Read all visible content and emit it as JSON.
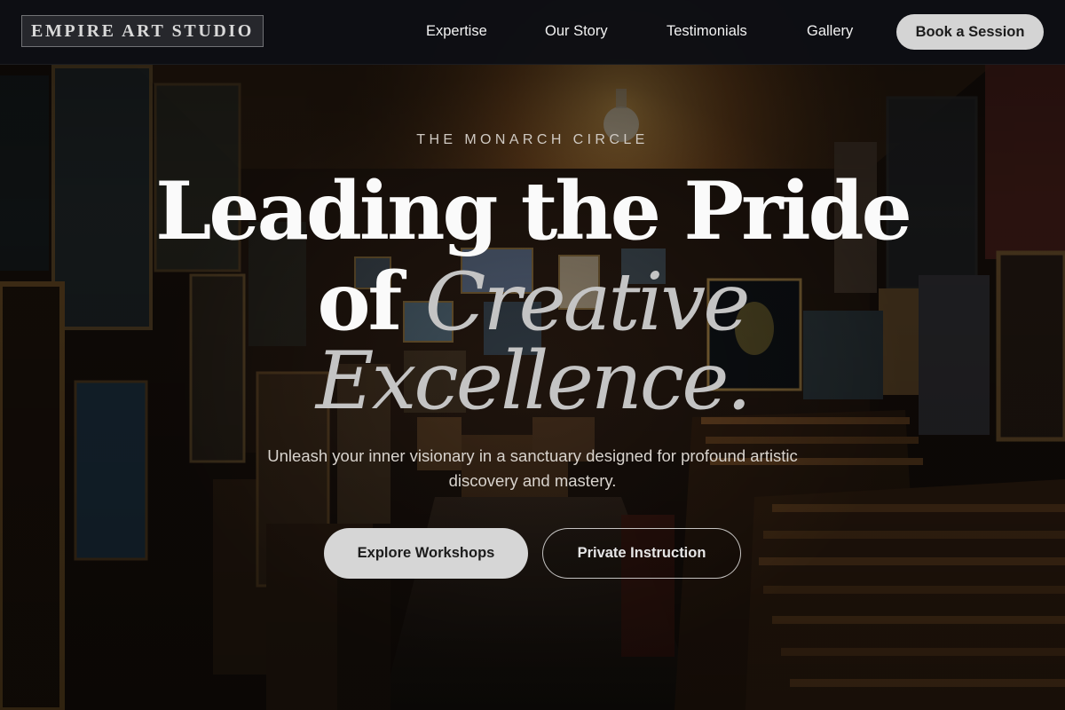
{
  "brand": {
    "logo_text": "EMPIRE ART STUDIO"
  },
  "nav": {
    "links": [
      "Expertise",
      "Our Story",
      "Testimonials",
      "Gallery"
    ],
    "cta_label": "Book a Session"
  },
  "hero": {
    "eyebrow": "THE MONARCH CIRCLE",
    "headline_line1": "Leading the Pride",
    "headline_line2_plain": "of",
    "headline_line2_italic": "Creative",
    "headline_line3_italic": "Excellence.",
    "subtitle": "Unleash your inner visionary in a sanctuary designed for profound artistic discovery and mastery.",
    "primary_cta": "Explore Workshops",
    "secondary_cta": "Private Instruction"
  },
  "colors": {
    "nav_background": "#0e0f14",
    "button_light": "#d6d6d6",
    "italic_accent": "#c4c4c4",
    "lamp_glow": "#f0b65a"
  }
}
